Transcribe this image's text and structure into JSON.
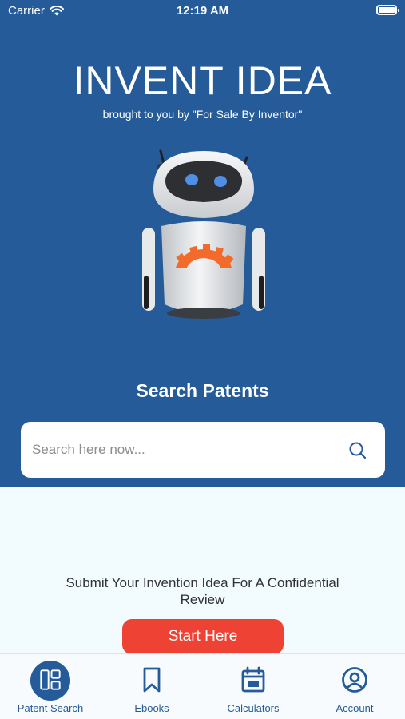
{
  "status_bar": {
    "carrier": "Carrier",
    "time": "12:19 AM",
    "battery_level": 1.0
  },
  "hero": {
    "title": "INVENT IDEA",
    "tagline": "brought to you by \"For Sale By Inventor\""
  },
  "search": {
    "heading": "Search Patents",
    "placeholder": "Search here now...",
    "value": ""
  },
  "cta": {
    "text": "Submit Your Invention Idea For A Confidential Review",
    "button_label": "Start Here"
  },
  "tabs": [
    {
      "label": "Patent Search",
      "icon": "grid-icon",
      "active": true
    },
    {
      "label": "Ebooks",
      "icon": "bookmark-icon",
      "active": false
    },
    {
      "label": "Calculators",
      "icon": "calendar-icon",
      "active": false
    },
    {
      "label": "Account",
      "icon": "user-circle-icon",
      "active": false
    }
  ],
  "colors": {
    "primary": "#255b98",
    "accent": "#ee4234",
    "background": "#f2fbfe",
    "robot_gear": "#f26b2a",
    "robot_eyes": "#4f8fe6"
  }
}
